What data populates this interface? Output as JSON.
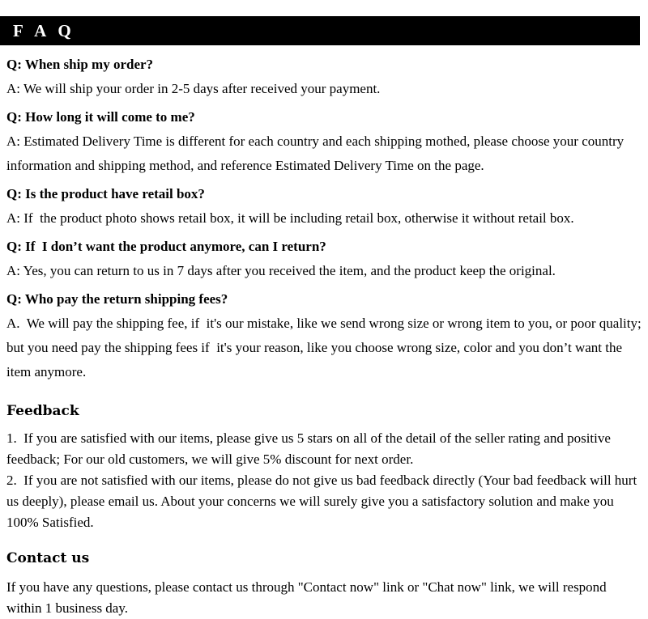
{
  "header": {
    "title": "F A Q",
    "background_color": "#000000",
    "text_color": "#ffffff"
  },
  "faq": {
    "items": [
      {
        "question": "Q: When ship my order?",
        "answer": "A: We will ship your order in 2-5 days after received your payment."
      },
      {
        "question": "Q: How long it will come to me?",
        "answer": "A: Estimated Delivery Time is different for each country and each shipping mothed, please choose your country information and shipping method, and reference Estimated Delivery Time on the page."
      },
      {
        "question": "Q: Is the product have retail box?",
        "answer": "A: If  the product photo shows retail box, it will be including retail box, otherwise it without retail box."
      },
      {
        "question": "Q: If  I don’t want the product anymore, can I return?",
        "answer": "A: Yes, you can return to us in 7 days after you received the item, and the product keep the original."
      },
      {
        "question": "Q: Who pay the return shipping fees?",
        "answer": "A.  We will pay the shipping fee, if  it's our mistake, like we send wrong size or wrong item to you, or poor quality; but you need pay the shipping fees if  it's your reason, like you choose wrong size, color and you don’t want the item anymore."
      }
    ]
  },
  "feedback": {
    "heading": "Feedback",
    "items": [
      "1.  If you are satisfied with our items, please give us 5 stars on all of the detail of the seller rating and positive feedback; For our old customers, we will give 5% discount for next order.",
      "2.  If you are not satisfied with our items, please do not give us bad feedback directly (Your bad feedback will hurt us deeply), please email us. About your concerns we will surely give you a satisfactory solution and make you 100% Satisfied."
    ]
  },
  "contact": {
    "heading": "Contact us",
    "body": "If you have any questions, please contact us through \"Contact now\" link or \"Chat now\" link, we will respond within 1 business day."
  }
}
